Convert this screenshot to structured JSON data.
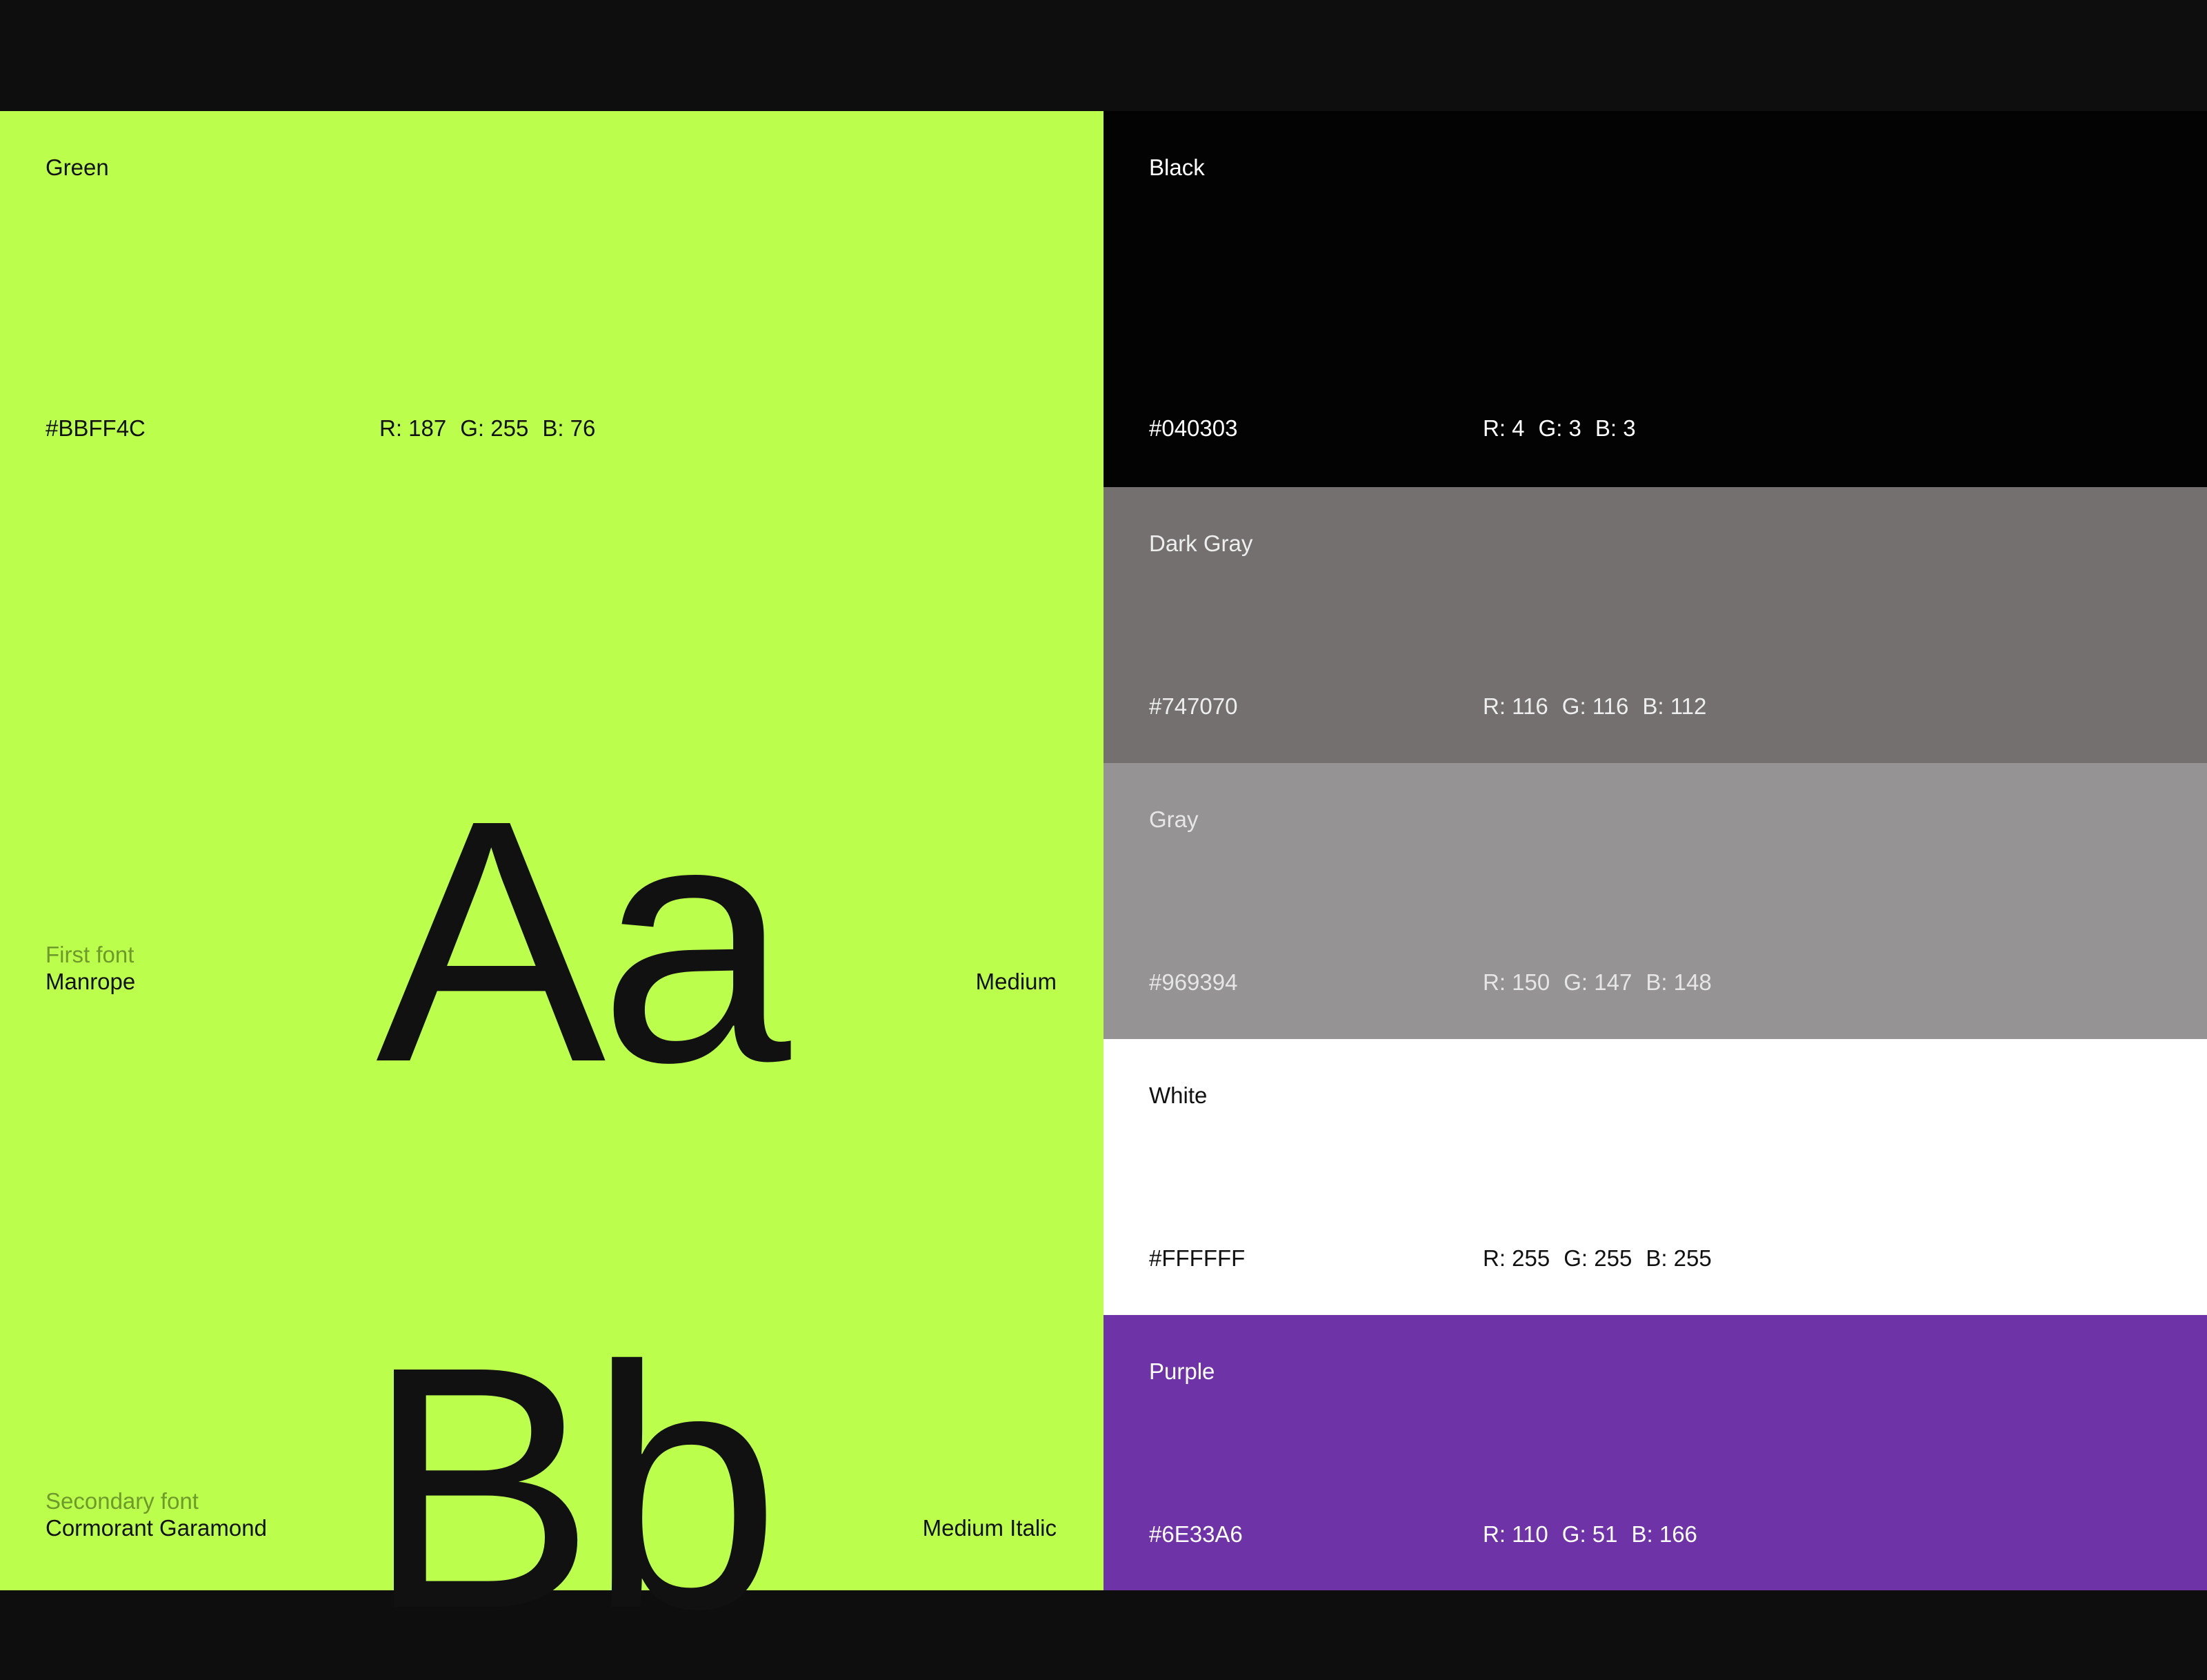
{
  "primary": {
    "name": "Green",
    "hex": "#BBFF4C",
    "rgb": {
      "r": "R: 187",
      "g": "G: 255",
      "b": "B: 76"
    },
    "color": "#BBFF4C"
  },
  "fonts": [
    {
      "role": "First font",
      "name": "Manrope",
      "sample": "Aa",
      "weight": "Medium"
    },
    {
      "role": "Secondary font",
      "name": "Cormorant Garamond",
      "sample": "Bb",
      "weight": "Medium Italic"
    }
  ],
  "swatches": [
    {
      "name": "Black",
      "hex": "#040303",
      "rgb": {
        "r": "R: 4",
        "g": "G: 3",
        "b": "B: 3"
      },
      "color": "#040303",
      "text_color": "#ffffff"
    },
    {
      "name": "Dark Gray",
      "hex": "#747070",
      "rgb": {
        "r": "R: 116",
        "g": "G: 116",
        "b": "B: 112"
      },
      "color": "#747070",
      "text_color": "#eeeeee"
    },
    {
      "name": "Gray",
      "hex": "#969394",
      "rgb": {
        "r": "R: 150",
        "g": "G: 147",
        "b": "B: 148"
      },
      "color": "#969394",
      "text_color": "#e6e6e6"
    },
    {
      "name": "White",
      "hex": "#FFFFFF",
      "rgb": {
        "r": "R: 255",
        "g": "G: 255",
        "b": "B: 255"
      },
      "color": "#FFFFFF",
      "text_color": "#111111"
    },
    {
      "name": "Purple",
      "hex": "#6E33A6",
      "rgb": {
        "r": "R: 110",
        "g": "G: 51",
        "b": "B: 166"
      },
      "color": "#6E33A6",
      "text_color": "#ffffff"
    }
  ]
}
